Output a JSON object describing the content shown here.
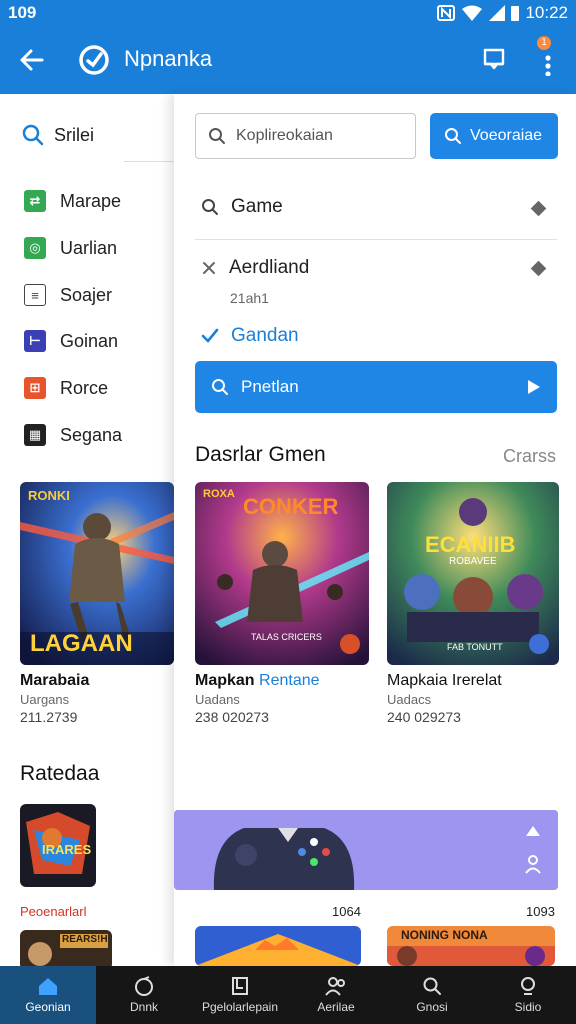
{
  "status_bar": {
    "time_left": "109",
    "time_right": "10:22"
  },
  "app_bar": {
    "title": "Npnanka",
    "badge": "1"
  },
  "drawer": {
    "search_label": "Srilei",
    "items": [
      {
        "label": "Marape",
        "icon": "arrows-icon",
        "color": "#34a853"
      },
      {
        "label": "Uarlian",
        "icon": "gear-icon",
        "color": "#34a853"
      },
      {
        "label": "Soajer",
        "icon": "list-icon",
        "color": "#ffffff"
      },
      {
        "label": "Goinan",
        "icon": "flag-icon",
        "color": "#3b3fb5"
      },
      {
        "label": "Rorce",
        "icon": "grid-icon",
        "color": "#e8552d"
      },
      {
        "label": "Segana",
        "icon": "layout-icon",
        "color": "#ffffff"
      }
    ],
    "featured": {
      "art_text_top": "RONKI",
      "art_text": "LAGAAN",
      "title": "Marabaia",
      "subtitle": "Uargans",
      "number": "211.2739"
    },
    "rated_heading": "Ratedaa",
    "rated_art_text": "IRARES",
    "rated_label": "Peoenarlarl",
    "rated_art2_text": "REARS!H"
  },
  "panel": {
    "search_placeholder": "Koplireokaian",
    "search_button": "Voeoraiae",
    "rows": [
      {
        "label": "Game",
        "icon": "search-icon"
      },
      {
        "label": "Aerdliand",
        "sub": "21ah1",
        "icon": "close-icon"
      },
      {
        "label": "Gandan",
        "icon": "check-icon"
      }
    ],
    "action_button": "Pnetlan",
    "section_title": "Dasrlar Gmen",
    "section_link": "Crarss",
    "cards": [
      {
        "art_text_top": "ROXA",
        "art_text": "CONKER",
        "art_caption": "TALAS CRICERS",
        "title": "Mapkan",
        "title_accent": "Rentane",
        "subtitle": "Uadans",
        "number": "238 020273"
      },
      {
        "art_text": "ECANIIB",
        "art_sub": "ROBAVEE",
        "art_caption": "FAB TONUTT",
        "title": "Mapkaia Irerelat",
        "subtitle": "Uadacs",
        "number": "240 029273"
      }
    ],
    "count_left": "1064",
    "count_right": "1093",
    "bottom_art_text": "NONING NONA"
  },
  "bottom_nav": [
    {
      "label": "Geonian",
      "icon": "home-icon"
    },
    {
      "label": "Dnnk",
      "icon": "gamepad-icon"
    },
    {
      "label": "Pgelolarlepain",
      "icon": "library-icon"
    },
    {
      "label": "Aerilae",
      "icon": "people-icon"
    },
    {
      "label": "Gnosi",
      "icon": "search-icon"
    },
    {
      "label": "Sidio",
      "icon": "profile-icon"
    }
  ]
}
